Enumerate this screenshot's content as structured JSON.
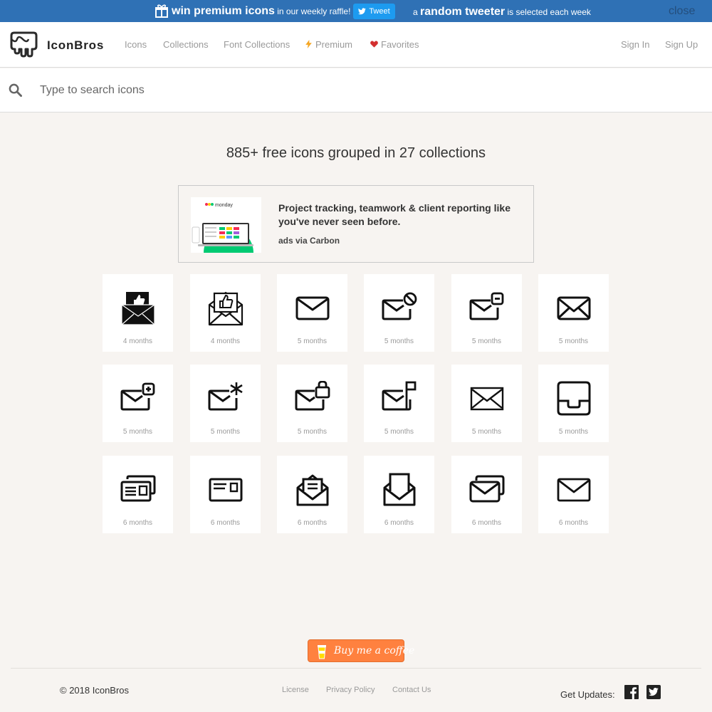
{
  "promo": {
    "win_bold": "win premium icons",
    "win_rest": " in our weekly raffle!",
    "tweet_label": "Tweet",
    "tweeter_pre": "a ",
    "tweeter_bold": "random tweeter",
    "tweeter_post": " is selected each week",
    "close_label": "close"
  },
  "nav": {
    "brand": "IconBros",
    "links": [
      "Icons",
      "Collections",
      "Font Collections",
      "Premium",
      "Favorites"
    ],
    "sign_in": "Sign In",
    "sign_up": "Sign Up"
  },
  "search": {
    "placeholder": "Type to search icons"
  },
  "headline": "885+ free icons grouped in 27 collections",
  "ad": {
    "brand": "monday",
    "text": "Project tracking, teamwork & client reporting like you've never seen before.",
    "via": "ads via Carbon"
  },
  "icons": [
    {
      "icon": "mail-like-filled-icon",
      "age": "4 months"
    },
    {
      "icon": "mail-like-outline-icon",
      "age": "4 months"
    },
    {
      "icon": "mail-icon",
      "age": "5 months"
    },
    {
      "icon": "mail-blocked-icon",
      "age": "5 months"
    },
    {
      "icon": "mail-remove-icon",
      "age": "5 months"
    },
    {
      "icon": "mail-alt-icon",
      "age": "5 months"
    },
    {
      "icon": "mail-add-icon",
      "age": "5 months"
    },
    {
      "icon": "mail-star-icon",
      "age": "5 months"
    },
    {
      "icon": "mail-locked-icon",
      "age": "5 months"
    },
    {
      "icon": "mail-flag-icon",
      "age": "5 months"
    },
    {
      "icon": "mail-open-lines-icon",
      "age": "5 months"
    },
    {
      "icon": "inbox-tray-icon",
      "age": "5 months"
    },
    {
      "icon": "postcards-stack-icon",
      "age": "6 months"
    },
    {
      "icon": "postcard-icon",
      "age": "6 months"
    },
    {
      "icon": "mail-letter-open-icon",
      "age": "6 months"
    },
    {
      "icon": "mail-open-icon",
      "age": "6 months"
    },
    {
      "icon": "mail-stack-icon",
      "age": "6 months"
    },
    {
      "icon": "mail-simple-icon",
      "age": "6 months"
    }
  ],
  "coffee_label": "Buy me a coffee",
  "footer": {
    "copyright": "© 2018 IconBros",
    "links": [
      "License",
      "Privacy Policy",
      "Contact Us"
    ],
    "updates": "Get Updates:"
  },
  "colors": {
    "promo_bg": "#2f71b5",
    "page_bg": "#f7f4f1",
    "coffee": "#ff813f",
    "heart": "#d32f2f",
    "bolt": "#f5a623"
  }
}
